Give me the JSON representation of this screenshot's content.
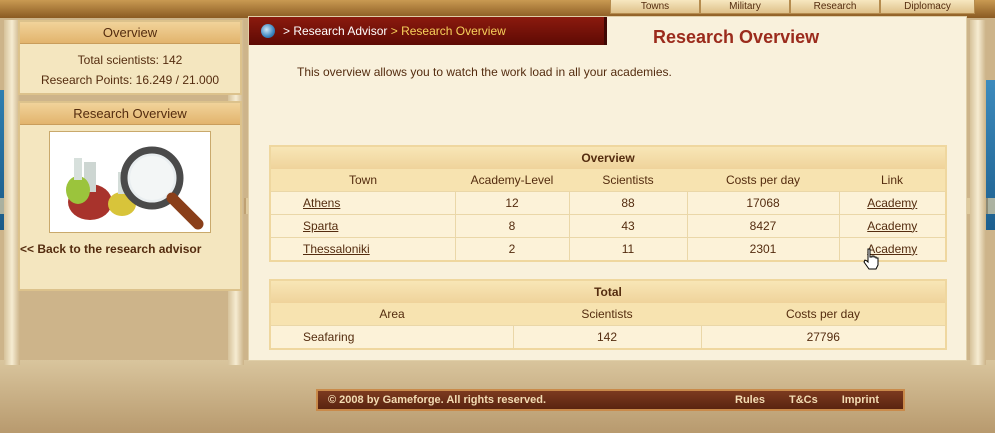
{
  "nav": {
    "tabs": [
      "Towns",
      "Military",
      "Research",
      "Diplomacy"
    ]
  },
  "sidebar": {
    "overview": {
      "title": "Overview",
      "total_scientists_label": "Total scientists: 142",
      "research_points_label": "Research Points: 16.249 / 21.000"
    },
    "research_overview": {
      "title": "Research Overview",
      "back_link": "<< Back to the research advisor"
    }
  },
  "breadcrumb": {
    "part1": "> Research Advisor",
    "part2": "> Research Overview"
  },
  "page": {
    "title": "Research Overview",
    "intro": "This overview allows you to watch the work load in all your academies."
  },
  "academies": {
    "title": "Overview",
    "headers": [
      "Town",
      "Academy-Level",
      "Scientists",
      "Costs per day",
      "Link"
    ],
    "rows": [
      {
        "town": "Athens",
        "level": "12",
        "scientists": "88",
        "costs": "17068",
        "link": "Academy"
      },
      {
        "town": "Sparta",
        "level": "8",
        "scientists": "43",
        "costs": "8427",
        "link": "Academy"
      },
      {
        "town": "Thessaloniki",
        "level": "2",
        "scientists": "11",
        "costs": "2301",
        "link": "Academy"
      }
    ]
  },
  "totals": {
    "title": "Total",
    "headers": [
      "Area",
      "Scientists",
      "Costs per day"
    ],
    "rows": [
      {
        "area": "Seafaring",
        "scientists": "142",
        "costs": "27796"
      }
    ]
  },
  "footer": {
    "copyright": "© 2008 by Gameforge. All rights reserved.",
    "links": [
      "Rules",
      "T&Cs",
      "Imprint"
    ]
  },
  "colors": {
    "breadcrumb_bg": "#7a1509",
    "title": "#9b2b1c",
    "text": "#542c0f",
    "crumb_highlight": "#f7d15b"
  }
}
